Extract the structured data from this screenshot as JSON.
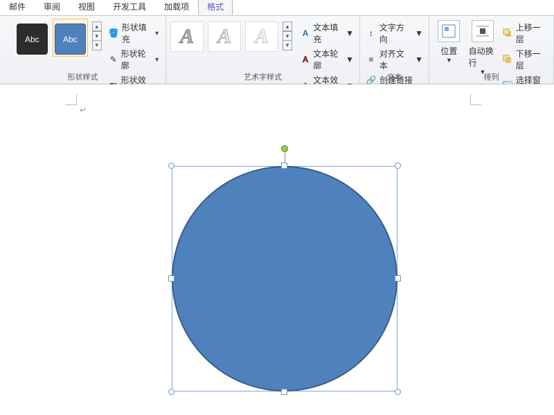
{
  "tabs": {
    "mail": "邮件",
    "review": "审阅",
    "view": "视图",
    "devtools": "开发工具",
    "addins": "加载项",
    "format": "格式"
  },
  "groups": {
    "shape_styles": "形状样式",
    "wordart_styles": "艺术字样式",
    "text": "文本",
    "arrange": "排列"
  },
  "shape": {
    "swatch_label": "Abc",
    "fill": "形状填充",
    "outline": "形状轮廓",
    "effects": "形状效果"
  },
  "wordart": {
    "glyph": "A",
    "text_fill": "文本填充",
    "text_outline": "文本轮廓",
    "text_effects": "文本效果"
  },
  "textgroup": {
    "direction": "文字方向",
    "align": "对齐文本",
    "link": "创建链接"
  },
  "arrange": {
    "position": "位置",
    "wrap": "自动换行",
    "bring_forward": "上移一层",
    "send_backward": "下移一层",
    "selection_pane": "选择窗格"
  },
  "canvas": {
    "shape_fill_color": "#4f81bd",
    "shape_outline_color": "#385d8a"
  }
}
